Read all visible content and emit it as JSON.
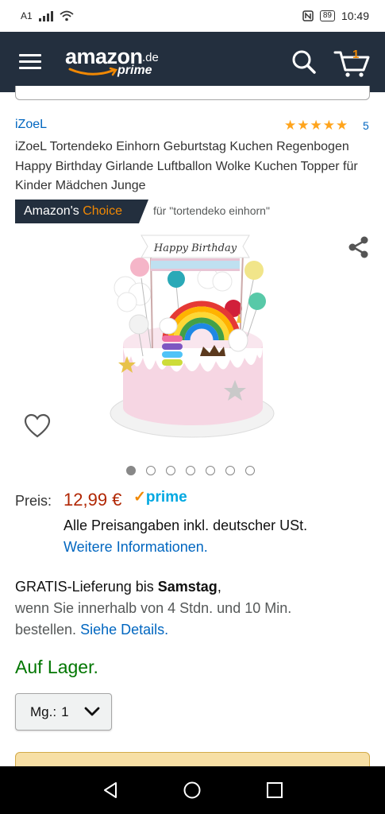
{
  "status_bar": {
    "carrier": "A1",
    "battery": "89",
    "time": "10:49"
  },
  "header": {
    "logo_word": "amazon",
    "logo_tld": ".de",
    "logo_sub": "prime",
    "cart_count": "1",
    "colors": {
      "background": "#232f3e",
      "accent": "#f08804"
    }
  },
  "product": {
    "brand": "iZoeL",
    "rating_stars": 5,
    "rating_count": "5",
    "title": "iZoeL Tortendeko Einhorn Geburtstag Kuchen Regenbogen Happy Birthday Girlande Luftballon Wolke Kuchen Topper für Kinder Mädchen Junge",
    "choice_badge": {
      "prefix": "Amazon's",
      "highlight": "Choice"
    },
    "choice_for": "für \"tortendeko einhorn\"",
    "image_banner": "Happy Birthday",
    "image_count": 7,
    "active_image": 0
  },
  "pricing": {
    "label": "Preis:",
    "value": "12,99 €",
    "prime": "prime",
    "vat_note": "Alle Preisangaben inkl. deutscher USt.",
    "more_info": "Weitere Informationen."
  },
  "delivery": {
    "prefix": "GRATIS-Lieferung bis",
    "day": "Samstag",
    "suffix": ",",
    "line2": "wenn Sie innerhalb von 4 Stdn. und 10 Min.",
    "line3_prefix": "bestellen.",
    "details_link": "Siehe Details."
  },
  "stock": "Auf Lager.",
  "quantity": {
    "label": "Mg.:",
    "value": "1"
  },
  "icons": [
    "menu-icon",
    "search-icon",
    "cart-icon",
    "share-icon",
    "heart-icon",
    "chevron-down-icon",
    "back-icon",
    "home-icon",
    "recent-apps-icon"
  ]
}
